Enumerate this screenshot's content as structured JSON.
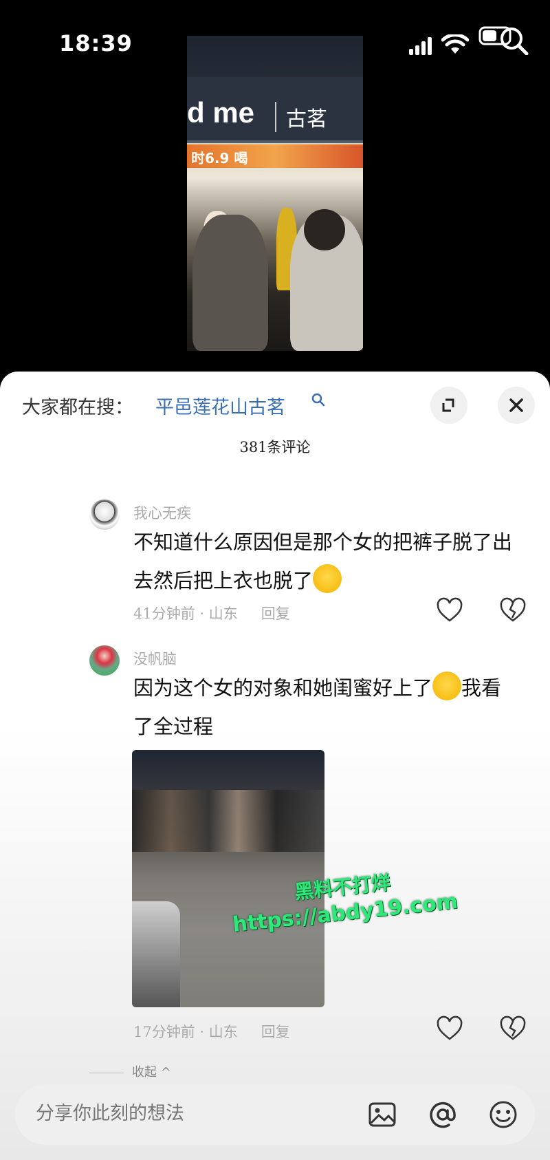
{
  "status_bar": {
    "time": "18:39"
  },
  "video": {
    "sign_text": "d me",
    "sign_cn": "古茗",
    "banner_text": "时6.9 喝"
  },
  "sheet": {
    "trend_label": "大家都在搜：",
    "trend_query": "平邑莲花山古茗",
    "comment_count": "381条评论",
    "comments": [
      {
        "user": "我心无疾",
        "text": "不知道什么原因但是那个女的把裤子脱了出去然后把上衣也脱了",
        "time": "41分钟前",
        "location": "山东",
        "reply": "回复"
      },
      {
        "user": "没帆脑",
        "text_a": "因为这个女的对象和她闺蜜好上了",
        "text_b": "我看了全过程",
        "time": "17分钟前",
        "location": "山东",
        "reply": "回复"
      }
    ],
    "more_replies": "收起",
    "watermark_line1": "黑料不打烊",
    "watermark_line2": "https://abdy19.com"
  },
  "input": {
    "placeholder": "分享你此刻的想法"
  }
}
